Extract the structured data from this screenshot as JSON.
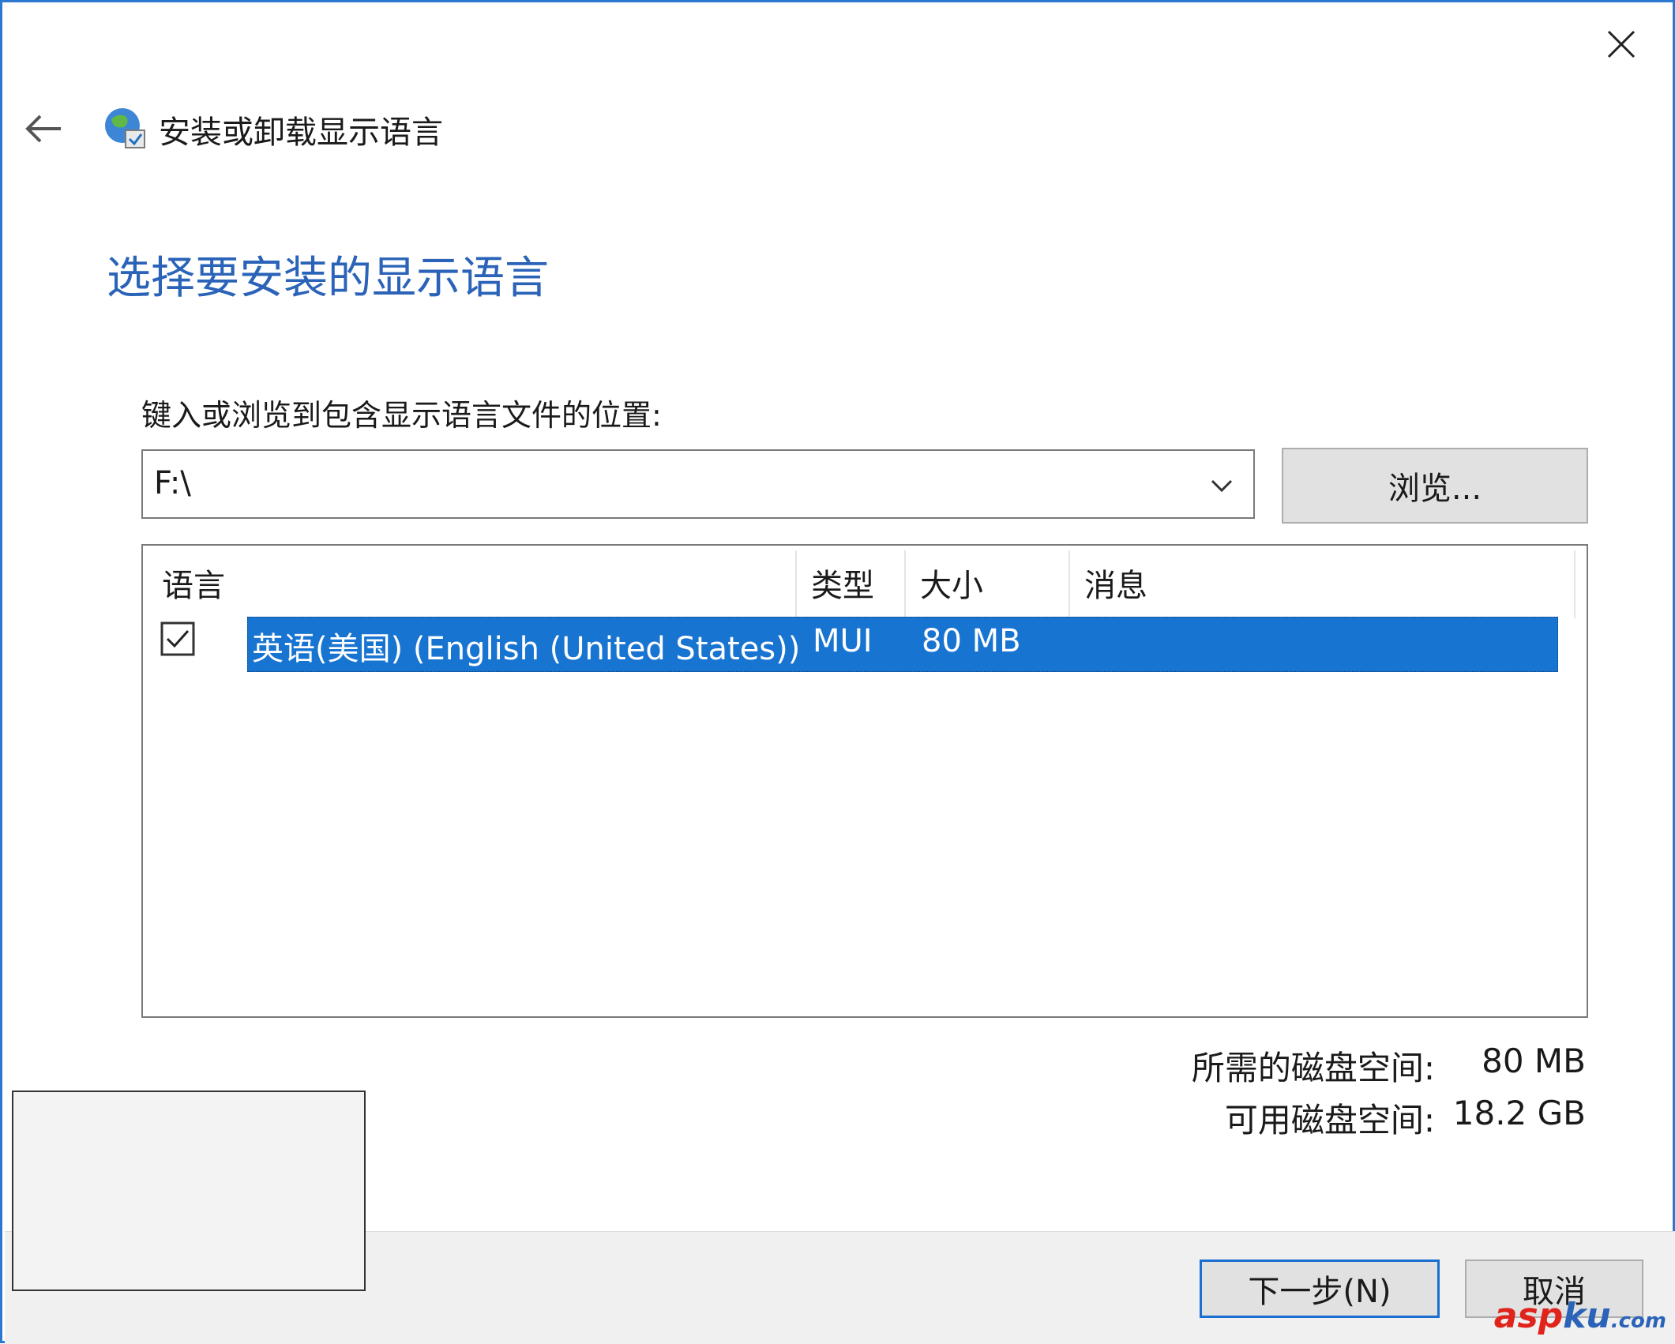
{
  "window": {
    "title": "安装或卸载显示语言",
    "back_icon": "back-arrow-icon",
    "close_icon": "close-icon",
    "app_icon": "globe-language-icon"
  },
  "main": {
    "heading": "选择要安装的显示语言",
    "location_label": "键入或浏览到包含显示语言文件的位置:",
    "location_value": "F:\\",
    "browse_label": "浏览..."
  },
  "list": {
    "columns": [
      "语言",
      "类型",
      "大小",
      "消息"
    ],
    "rows": [
      {
        "checked": true,
        "language": "英语(美国) (English (United States))",
        "type": "MUI",
        "size": "80 MB",
        "message": ""
      }
    ]
  },
  "space": {
    "required_label": "所需的磁盘空间:",
    "required_value": "80 MB",
    "available_label": "可用磁盘空间:",
    "available_value": "18.2 GB"
  },
  "footer": {
    "next_label": "下一步(N)",
    "cancel_label": "取消"
  },
  "watermark": {
    "part1": "asp",
    "part2": "ku",
    "part3": ".com"
  },
  "colors": {
    "accent": "#2a63b8",
    "selection": "#1874d1",
    "border": "#2b78d0"
  }
}
